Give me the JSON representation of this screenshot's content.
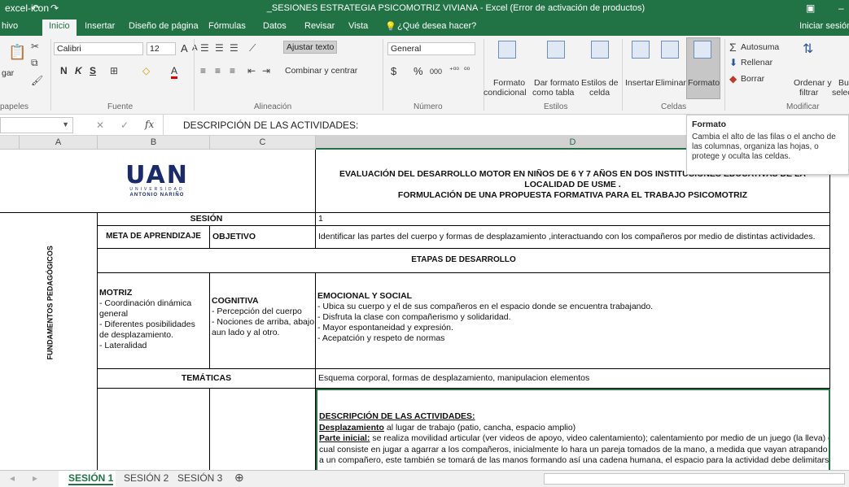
{
  "titlebar": {
    "app_icon": "excel-icon",
    "undo": "↶",
    "redo": "↷",
    "title": "_SESIONES ESTRATEGIA PSICOMOTRIZ VIVIANA - Excel (Error de activación de productos)",
    "window_icon": "▣",
    "minimize": "–"
  },
  "tabs": [
    "hivo",
    "Inicio",
    "Insertar",
    "Diseño de página",
    "Fórmulas",
    "Datos",
    "Revisar",
    "Vista"
  ],
  "tell_me": "¿Qué desea hacer?",
  "signin": "Iniciar sesión",
  "ribbon": {
    "clipboard": {
      "paste": "gar",
      "group": "papeles"
    },
    "font": {
      "name": "Calibri",
      "size": "12",
      "bold": "N",
      "italic": "K",
      "underline": "S",
      "grow": "A",
      "shrink": "A",
      "color": "A",
      "group": "Fuente"
    },
    "alignment": {
      "wrap": "Ajustar texto",
      "merge": "Combinar y centrar",
      "group": "Alineación"
    },
    "number": {
      "format": "General",
      "currency": "$",
      "percent": "%",
      "thousands": "000",
      "inc_dec": "⁺⁰⁰",
      "dec_dec": "⁰⁰",
      "group": "Número"
    },
    "styles": {
      "cond_1": "Formato",
      "cond_2": "condicional",
      "table_1": "Dar formato",
      "table_2": "como tabla",
      "cell_1": "Estilos de",
      "cell_2": "celda",
      "group": "Estilos"
    },
    "cells": {
      "insert": "Insertar",
      "delete": "Eliminar",
      "format": "Formato",
      "group": "Celdas"
    },
    "editing": {
      "autosum": "Autosuma",
      "fill": "Rellenar",
      "clear": "Borrar",
      "sort_1": "Ordenar y",
      "sort_2": "filtrar",
      "find_1": "Bu",
      "find_2": "selec",
      "group": "Modificar"
    }
  },
  "formula_bar": {
    "fx": "fx",
    "cancel": "✕",
    "enter": "✓",
    "content": "DESCRIPCIÓN DE LAS ACTIVIDADES:"
  },
  "tooltip": {
    "title": "Formato",
    "body": "Cambia el alto de las filas o el ancho de las columnas, organiza las hojas, o protege y oculta las celdas."
  },
  "columns": [
    "A",
    "B",
    "C",
    "D"
  ],
  "sheet": {
    "logo_text": "UAN",
    "logo_sub1": "UNIVERSIDAD",
    "logo_sub2": "ANTONIO NARIÑO",
    "title_line1": "EVALUACIÓN DEL DESARROLLO MOTOR EN NIÑOS DE 6 Y 7 AÑOS EN DOS INSTITUCIONES EDUCATIVAS DE LA LOCALIDAD DE USME .",
    "title_line2": "FORMULACIÓN DE UNA PROPUESTA FORMATIVA PARA EL TRABAJO PSICOMOTRIZ",
    "fundamentos": "FUNDAMENTOS PEDAGÓGICOS",
    "sesion_label": "SESIÓN",
    "sesion_value": "1",
    "meta_label": "META DE APRENDIZAJE",
    "objetivo_label": "OBJETIVO",
    "objetivo_value": "Identificar las partes del cuerpo y formas de desplazamiento ,interactuando con los compañeros por medio de distintas actividades.",
    "etapas": "ETAPAS DE DESARROLLO",
    "motriz_title": "MOTRIZ",
    "motriz_lines": [
      "- Coordinación dinámica",
      "general",
      "- Diferentes posibilidades",
      "de desplazamiento.",
      "- Lateralidad"
    ],
    "cognitiva_title": "COGNITIVA",
    "cognitiva_lines": [
      "- Percepción del cuerpo",
      "- Nociones de arriba, abajo,",
      "aun lado y al otro."
    ],
    "emocional_title": "EMOCIONAL Y SOCIAL",
    "emocional_lines": [
      "- Ubica su cuerpo y el de sus compañeros en el espacio donde se encuentra trabajando.",
      "- Disfruta la clase con compañerismo y solidaridad.",
      "- Mayor espontaneidad y expresión.",
      "- Acepatción y respeto de normas"
    ],
    "tematicas_label": "TEMÁTICAS",
    "tematicas_value": "Esquema corporal, formas de desplazamiento, manipulacion elementos",
    "desc_title": "DESCRIPCIÓN DE LAS ACTIVIDADES:",
    "desp_label": "Desplazamiento",
    "desp_text": " al lugar de trabajo (patio, cancha, espacio amplio)",
    "parte_label": "Parte inicial:",
    "parte_text": " se realiza movilidad articular (ver videos de apoyo, video calentamiento); calentamiento por medio de un juego (la lleva) el",
    "line3": "cual consiste en jugar a agarrar a los compañeros, inicialmente lo hara un pareja tomados de la mano, a medida que vayan atrapando",
    "line4": "a un compañero, este también se tomará de las manos formando así una cadena humana, el espacio para la actividad debe delimitarse,"
  },
  "sheet_tabs": [
    "SESIÓN 1",
    "SESIÓN 2",
    "SESIÓN 3"
  ],
  "add_sheet": "⊕",
  "colors": {
    "excel_green": "#217346",
    "ribbon_bg": "#f3f3f3",
    "logo_blue": "#1b2a6b"
  }
}
